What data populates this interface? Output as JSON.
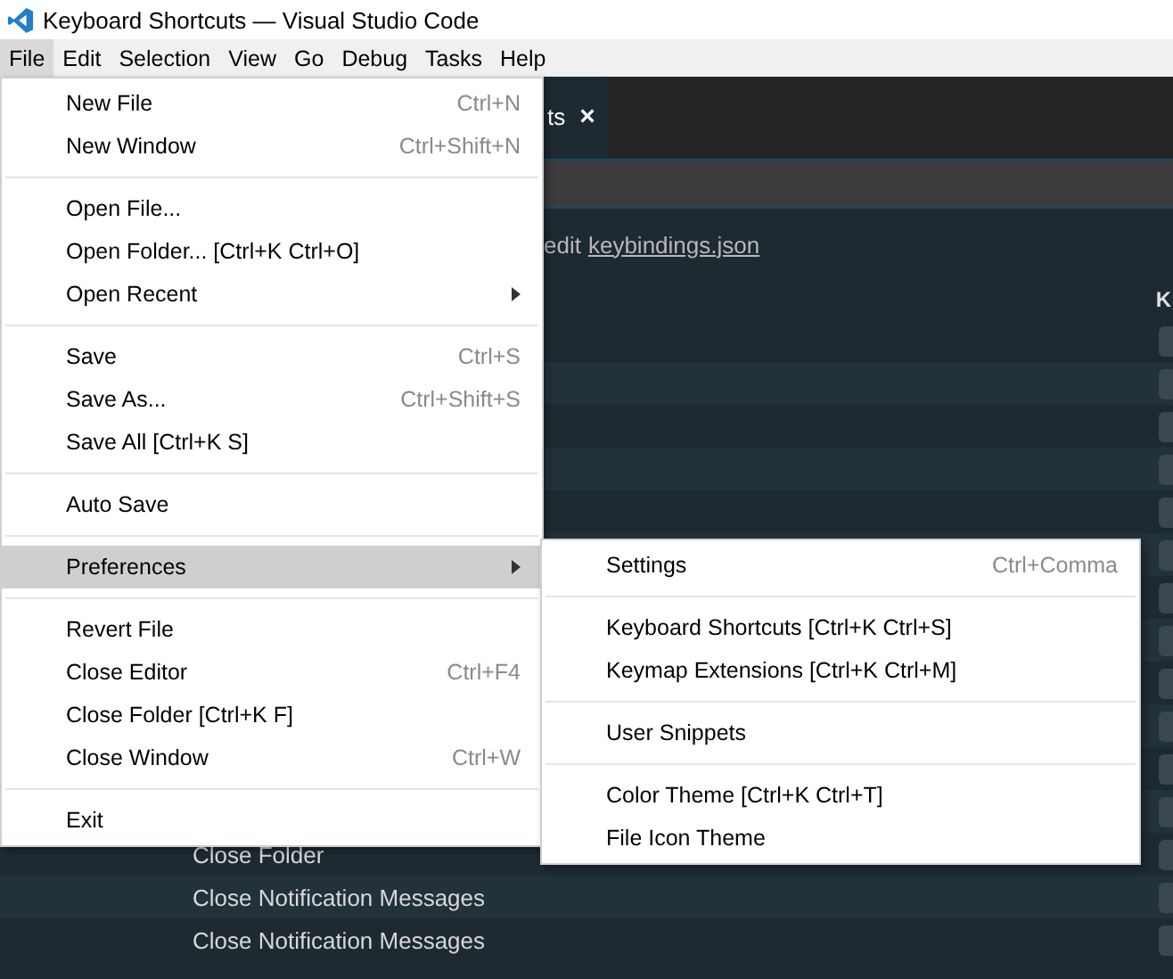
{
  "window": {
    "title": "Keyboard Shortcuts — Visual Studio Code"
  },
  "menubar": [
    {
      "label": "File",
      "selected": true
    },
    {
      "label": "Edit",
      "selected": false
    },
    {
      "label": "Selection",
      "selected": false
    },
    {
      "label": "View",
      "selected": false
    },
    {
      "label": "Go",
      "selected": false
    },
    {
      "label": "Debug",
      "selected": false
    },
    {
      "label": "Tasks",
      "selected": false
    },
    {
      "label": "Help",
      "selected": false
    }
  ],
  "editor_tab": {
    "label": "ts",
    "close": "×"
  },
  "hint": {
    "text": "edit",
    "link": "keybindings.json"
  },
  "table": {
    "column_3": "K",
    "rows": [
      {
        "command": "Close Folder"
      },
      {
        "command": "Close Notification Messages"
      },
      {
        "command": "Close Notification Messages"
      }
    ]
  },
  "file_menu": {
    "groups": [
      [
        {
          "label": "New File",
          "shortcut": "Ctrl+N",
          "submenu": false,
          "selected": false
        },
        {
          "label": "New Window",
          "shortcut": "Ctrl+Shift+N",
          "submenu": false,
          "selected": false
        }
      ],
      [
        {
          "label": "Open File...",
          "submenu": false,
          "selected": false
        },
        {
          "label": "Open Folder... [Ctrl+K Ctrl+O]",
          "submenu": false,
          "selected": false
        },
        {
          "label": "Open Recent",
          "submenu": true,
          "selected": false
        }
      ],
      [
        {
          "label": "Save",
          "shortcut": "Ctrl+S",
          "submenu": false,
          "selected": false
        },
        {
          "label": "Save As...",
          "shortcut": "Ctrl+Shift+S",
          "submenu": false,
          "selected": false
        },
        {
          "label": "Save All [Ctrl+K S]",
          "submenu": false,
          "selected": false
        }
      ],
      [
        {
          "label": "Auto Save",
          "submenu": false,
          "selected": false
        }
      ],
      [
        {
          "label": "Preferences",
          "submenu": true,
          "selected": true
        }
      ],
      [
        {
          "label": "Revert File",
          "submenu": false,
          "selected": false
        },
        {
          "label": "Close Editor",
          "shortcut": "Ctrl+F4",
          "submenu": false,
          "selected": false
        },
        {
          "label": "Close Folder [Ctrl+K F]",
          "submenu": false,
          "selected": false
        },
        {
          "label": "Close Window",
          "shortcut": "Ctrl+W",
          "submenu": false,
          "selected": false
        }
      ],
      [
        {
          "label": "Exit",
          "submenu": false,
          "selected": false
        }
      ]
    ]
  },
  "preferences_menu": {
    "groups": [
      [
        {
          "label": "Settings",
          "shortcut": "Ctrl+Comma",
          "submenu": false,
          "selected": false
        }
      ],
      [
        {
          "label": "Keyboard Shortcuts [Ctrl+K Ctrl+S]",
          "submenu": false,
          "selected": false
        },
        {
          "label": "Keymap Extensions [Ctrl+K Ctrl+M]",
          "submenu": false,
          "selected": false
        }
      ],
      [
        {
          "label": "User Snippets",
          "submenu": false,
          "selected": false
        }
      ],
      [
        {
          "label": "Color Theme [Ctrl+K Ctrl+T]",
          "submenu": false,
          "selected": false
        },
        {
          "label": "File Icon Theme",
          "submenu": false,
          "selected": false
        }
      ]
    ]
  }
}
